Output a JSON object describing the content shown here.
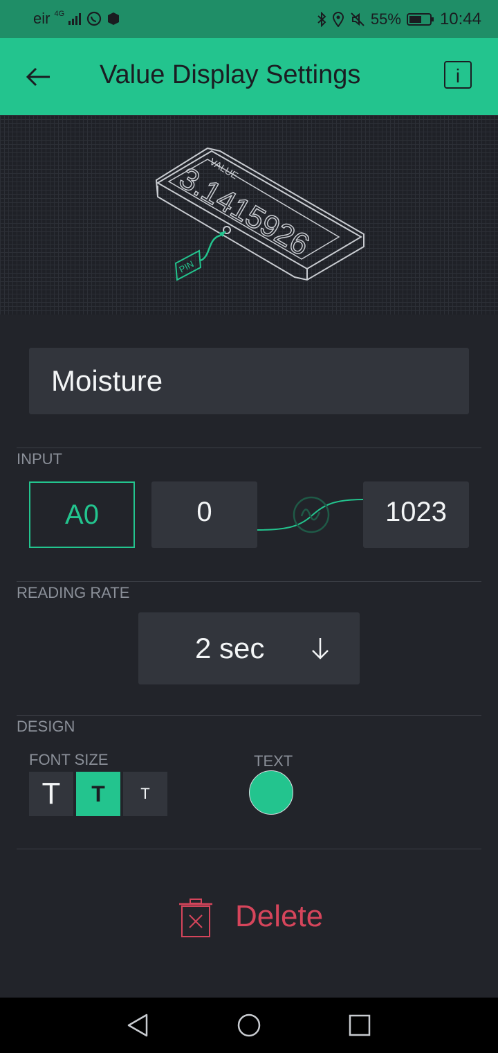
{
  "status_bar": {
    "carrier": "eir",
    "network": "4G",
    "battery_percent": "55%",
    "time": "10:44"
  },
  "app_bar": {
    "title": "Value Display Settings",
    "info_label": "i"
  },
  "hero": {
    "display_label": "VALUE",
    "display_value": "3.1415926",
    "pin_label": "PIN"
  },
  "widget_name": "Moisture",
  "input": {
    "section_label": "INPUT",
    "pin": "A0",
    "min": "0",
    "max": "1023"
  },
  "reading_rate": {
    "section_label": "READING RATE",
    "value": "2 sec"
  },
  "design": {
    "section_label": "DESIGN",
    "font_size_label": "FONT SIZE",
    "font_size_options": [
      "T",
      "T",
      "T"
    ],
    "selected_font_size": 1,
    "text_color_label": "TEXT",
    "text_color": "#23c48e"
  },
  "delete_label": "Delete",
  "colors": {
    "accent": "#23c48e",
    "status_bar": "#1f8e67",
    "background": "#22242a",
    "field": "#32353c",
    "danger": "#d6455b"
  },
  "icons": [
    "back-arrow-icon",
    "info-icon",
    "chevron-down-icon",
    "trash-icon",
    "nav-back-icon",
    "nav-home-icon",
    "nav-recents-icon"
  ]
}
